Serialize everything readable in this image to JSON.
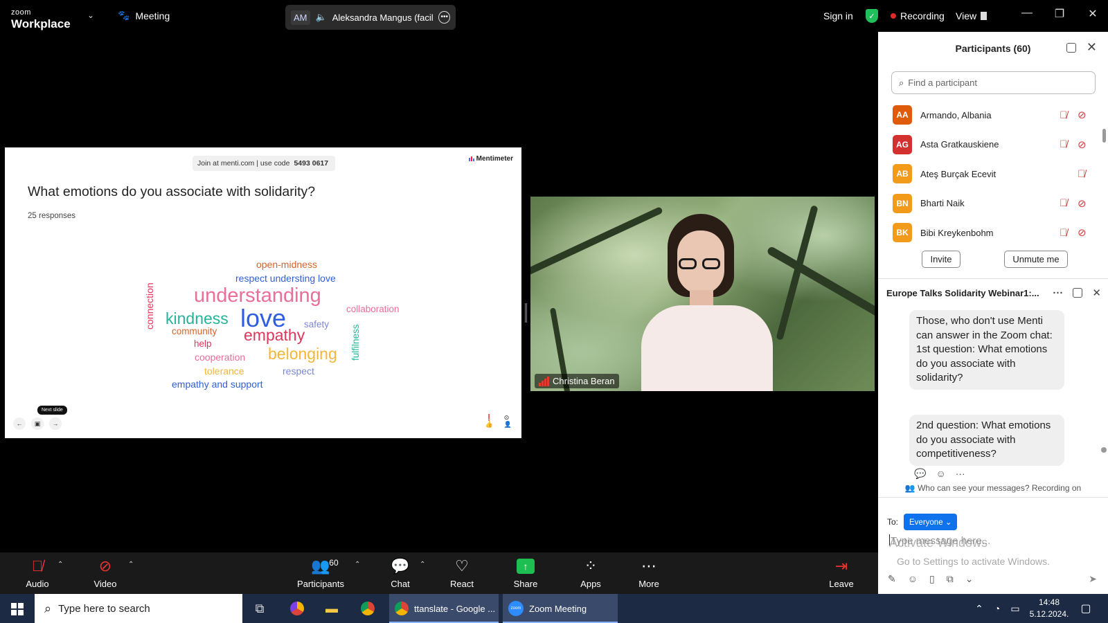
{
  "topbar": {
    "brand_small": "zoom",
    "brand_large": "Workplace",
    "meeting_label": "Meeting",
    "speaker_initials": "AM",
    "speaker_name": "Aleksandra Mangus (facilitat",
    "sign_in": "Sign in",
    "recording": "Recording",
    "view": "View"
  },
  "slide": {
    "join_text": "Join at menti.com | use code",
    "join_code": "5493 0617",
    "brand": "Mentimeter",
    "question": "What emotions do you associate with solidarity?",
    "responses": "25 responses",
    "tooltip": "Next slide",
    "words": [
      {
        "text": "open-midness",
        "color": "#d9622b"
      },
      {
        "text": "respect understing love",
        "color": "#2f5fd8"
      },
      {
        "text": "understanding",
        "color": "#ea6e9a"
      },
      {
        "text": "connection",
        "color": "#e0365a"
      },
      {
        "text": "kindness",
        "color": "#22b59a"
      },
      {
        "text": "love",
        "color": "#2f5fe0"
      },
      {
        "text": "collaboration",
        "color": "#ea6e9a"
      },
      {
        "text": "community",
        "color": "#d9622b"
      },
      {
        "text": "empathy",
        "color": "#e0365a"
      },
      {
        "text": "safety",
        "color": "#7d86d9"
      },
      {
        "text": "help",
        "color": "#e0365a"
      },
      {
        "text": "fulfilness",
        "color": "#22b59a"
      },
      {
        "text": "belonging",
        "color": "#f4b63a"
      },
      {
        "text": "cooperation",
        "color": "#ea6e9a"
      },
      {
        "text": "tolerance",
        "color": "#f4b63a"
      },
      {
        "text": "respect",
        "color": "#7d86d9"
      },
      {
        "text": "empathy and support",
        "color": "#2f5fd8"
      }
    ]
  },
  "video": {
    "name": "Christina Beran"
  },
  "participants": {
    "title": "Participants (60)",
    "search_placeholder": "Find a participant",
    "list": [
      {
        "initials": "AA",
        "name": "Armando, Albania",
        "color": "#e05a0c"
      },
      {
        "initials": "AG",
        "name": "Asta Gratkauskiene",
        "color": "#d3312f"
      },
      {
        "initials": "AB",
        "name": "Ateş Burçak Ecevit",
        "color": "#f29b1a"
      },
      {
        "initials": "BN",
        "name": "Bharti Naik",
        "color": "#f29b1a"
      },
      {
        "initials": "BK",
        "name": "Bibi Kreykenbohm",
        "color": "#f29b1a"
      }
    ],
    "invite": "Invite",
    "unmute": "Unmute me"
  },
  "chat": {
    "title": "Europe Talks Solidarity Webinar1:...",
    "bubble1": "Those, who don't use Menti can answer in the Zoom chat:\n1st question: What emotions do you associate with solidarity?",
    "bubble2": "2nd question: What emotions do you associate with competitiveness?",
    "who_can": "Who can see your messages? Recording on",
    "to_label": "To:",
    "to_value": "Everyone",
    "placeholder": "Type message here...",
    "activate_title": "Activate Windows",
    "activate_sub": "Go to Settings to activate Windows."
  },
  "toolbar": {
    "audio": "Audio",
    "video": "Video",
    "participants": "Participants",
    "participants_count": "60",
    "chat": "Chat",
    "react": "React",
    "share": "Share",
    "apps": "Apps",
    "more": "More",
    "leave": "Leave"
  },
  "taskbar": {
    "search_placeholder": "Type here to search",
    "app1": "ttanslate - Google ...",
    "app2": "Zoom Meeting",
    "time": "14:48",
    "date": "5.12.2024."
  }
}
